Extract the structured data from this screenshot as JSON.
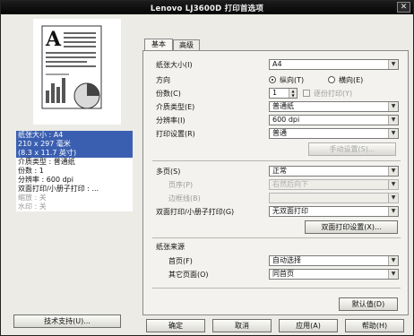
{
  "window": {
    "title": "Lenovo LJ3600D 打印首选项",
    "close_label": "✕"
  },
  "left": {
    "spec_lines": [
      {
        "text": "纸张大小 : A4",
        "hl": true
      },
      {
        "text": "210 x 297 毫米",
        "hl": true
      },
      {
        "text": "(8.3 x 11.7 英寸)",
        "hl": true
      },
      {
        "text": "介质类型 : 普通纸",
        "hl": false
      },
      {
        "text": "份数 : 1",
        "hl": false
      },
      {
        "text": "分辨率 : 600 dpi",
        "hl": false
      },
      {
        "text": "双面打印/小册子打印 : ...",
        "hl": false
      },
      {
        "text": "缩放 : 关",
        "hl": false,
        "gray": true
      },
      {
        "text": "水印 : 关",
        "hl": false,
        "gray": true
      }
    ],
    "support_button": "技术支持(U)..."
  },
  "tabs": {
    "basic": "基本",
    "advanced": "高级"
  },
  "basic": {
    "paper_size": {
      "label": "纸张大小(I)",
      "value": "A4"
    },
    "orientation": {
      "label": "方向",
      "portrait": "纵向(T)",
      "landscape": "横向(E)"
    },
    "copies": {
      "label": "份数(C)",
      "value": "1",
      "collate": "逐份打印(Y)"
    },
    "media_type": {
      "label": "介质类型(E)",
      "value": "普通纸"
    },
    "resolution": {
      "label": "分辨率(I)",
      "value": "600 dpi"
    },
    "print_settings": {
      "label": "打印设置(R)",
      "value": "普通",
      "manual_button": "手动设置(S)..."
    },
    "multipage": {
      "label": "多页(S)",
      "value": "正常"
    },
    "page_order": {
      "label": "页序(P)",
      "value": "右然后向下"
    },
    "border": {
      "label": "边框线(B)",
      "value": ""
    },
    "duplex": {
      "label": "双面打印/小册子打印(G)",
      "value": "无双面打印",
      "settings_button": "双面打印设置(X)..."
    },
    "paper_source_heading": "纸张来源",
    "first_page": {
      "label": "首页(F)",
      "value": "自动选择"
    },
    "other_pages": {
      "label": "其它页面(O)",
      "value": "同首页"
    },
    "default_button": "默认值(D)"
  },
  "footer": {
    "ok": "确定",
    "cancel": "取消",
    "apply": "应用(A)",
    "help": "帮助(H)"
  }
}
